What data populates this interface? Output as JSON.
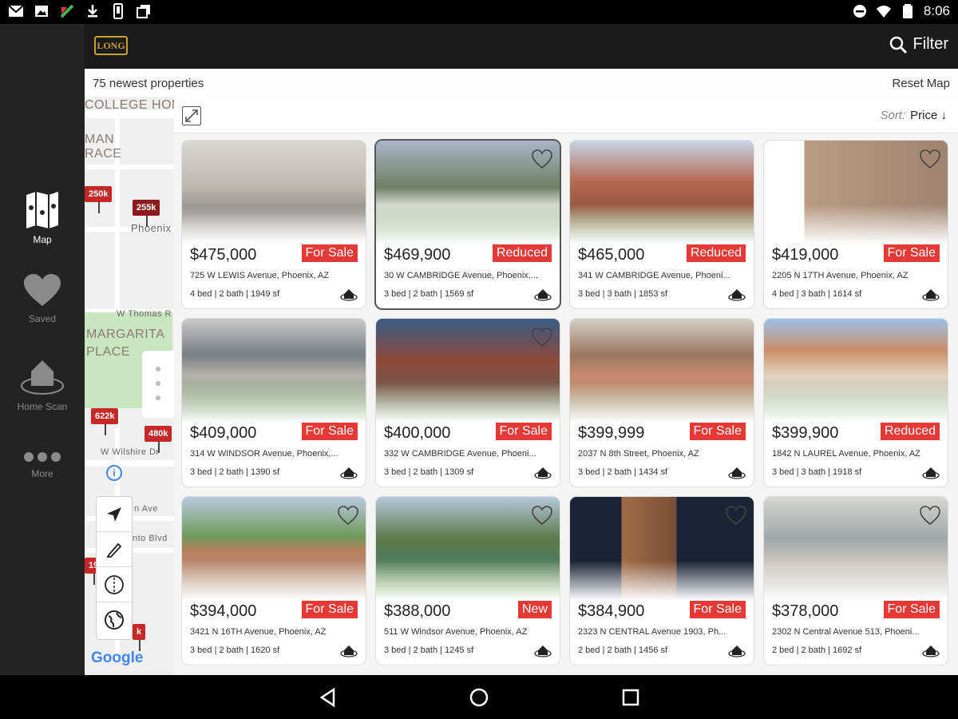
{
  "status_bar": {
    "time": "8:06",
    "left_icons": [
      "gmail-icon",
      "photo-icon",
      "app-icon",
      "download-icon",
      "phone-icon",
      "copy-icon"
    ],
    "right_icons": [
      "minus-circle-icon",
      "wifi-icon",
      "battery-icon"
    ]
  },
  "nav": {
    "items": [
      {
        "label": "Map",
        "icon": "map-icon",
        "active": true
      },
      {
        "label": "Saved",
        "icon": "heart-icon",
        "active": false
      },
      {
        "label": "Home Scan",
        "icon": "home-scan-icon",
        "active": false
      },
      {
        "label": "More",
        "icon": "more-dots-icon",
        "active": false
      }
    ]
  },
  "appbar": {
    "logo_text": "LONG",
    "filter_label": "Filter"
  },
  "map": {
    "newest_label": "75 newest properties",
    "reset_label": "Reset Map",
    "labels": {
      "college": "COLLEGE HOM",
      "terrace": "MAN RACE",
      "margarita": "MARGARITA PLACE",
      "phoenix": "Phoenix",
      "thomas": "W Thomas R",
      "wilshire": "W Wilshire Dr",
      "ave": "n Ave",
      "blvd": "nto Blvd",
      "google": "Google"
    },
    "pins": {
      "p250": "250k",
      "p255": "255k",
      "p622": "622k",
      "p480": "480k",
      "p19": "19",
      "pk": "k"
    }
  },
  "panel": {
    "sort_label": "Sort:",
    "sort_value": "Price ↓",
    "cards": [
      {
        "price": "$475,000",
        "badge": "For Sale",
        "address": "725 W LEWIS Avenue, Phoenix, AZ",
        "specs": "4 bed | 2 bath | 1949 sf"
      },
      {
        "price": "$469,900",
        "badge": "Reduced",
        "address": "30 W CAMBRIDGE Avenue, Phoenix,...",
        "specs": "3 bed | 2 bath | 1569 sf"
      },
      {
        "price": "$465,000",
        "badge": "Reduced",
        "address": "341 W CAMBRIDGE Avenue, Phoeni...",
        "specs": "3 bed | 3 bath | 1853 sf"
      },
      {
        "price": "$419,000",
        "badge": "For Sale",
        "address": "2205 N 17TH Avenue, Phoenix, AZ",
        "specs": "4 bed | 3 bath | 1614 sf"
      },
      {
        "price": "$409,000",
        "badge": "For Sale",
        "address": "314 W WINDSOR Avenue, Phoenix,...",
        "specs": "3 bed | 2 bath | 1390 sf"
      },
      {
        "price": "$400,000",
        "badge": "For Sale",
        "address": "332 W CAMBRIDGE Avenue, Phoeni...",
        "specs": "3 bed | 2 bath | 1309 sf"
      },
      {
        "price": "$399,999",
        "badge": "For Sale",
        "address": "2037 N 8th Street, Phoenix, AZ",
        "specs": "3 bed | 2 bath | 1434 sf"
      },
      {
        "price": "$399,900",
        "badge": "Reduced",
        "address": "1842 N LAUREL Avenue, Phoenix, AZ",
        "specs": "3 bed | 3 bath | 1918 sf"
      },
      {
        "price": "$394,000",
        "badge": "For Sale",
        "address": "3421 N 16TH Avenue, Phoenix, AZ",
        "specs": "3 bed | 2 bath | 1620 sf"
      },
      {
        "price": "$388,000",
        "badge": "New",
        "address": "511 W Windsor Avenue, Phoenix, AZ",
        "specs": "3 bed | 2 bath | 1245 sf"
      },
      {
        "price": "$384,900",
        "badge": "For Sale",
        "address": "2323 N CENTRAL Avenue 1903, Ph...",
        "specs": "2 bed | 2 bath | 1456 sf"
      },
      {
        "price": "$378,000",
        "badge": "For Sale",
        "address": "2302 N Central Avenue 513, Phoeni...",
        "specs": "2 bed | 2 bath | 1692 sf"
      }
    ]
  },
  "colors": {
    "badge_red": "#e53935",
    "pin_red": "#c62828",
    "logo_gold": "#c9a227",
    "nav_bg": "#232323"
  }
}
